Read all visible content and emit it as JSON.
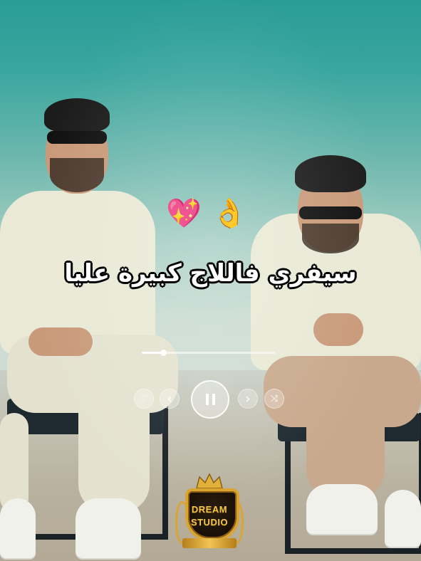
{
  "overlay": {
    "emojis": [
      "💖",
      "👌"
    ],
    "lyric": "سيفري فاللاج كبيرة عليا"
  },
  "player": {
    "progress": 0.16,
    "controls": {
      "like_icon": "heart-outline-icon",
      "prev_icon": "chevron-left-icon",
      "play_icon": "pause-icon",
      "next_icon": "chevron-right-icon",
      "shuffle_icon": "shuffle-icon"
    },
    "glyphs": {
      "like": "♡",
      "prev": "‹",
      "next": "›",
      "shuffle": "⤨"
    }
  },
  "logo": {
    "line1": "DREAM",
    "line2": "STUDIO",
    "accent": "#d9a530"
  },
  "colors": {
    "sky_top": "#2a9c96",
    "lyric_text": "#ffffff",
    "lyric_outline": "#000000"
  }
}
